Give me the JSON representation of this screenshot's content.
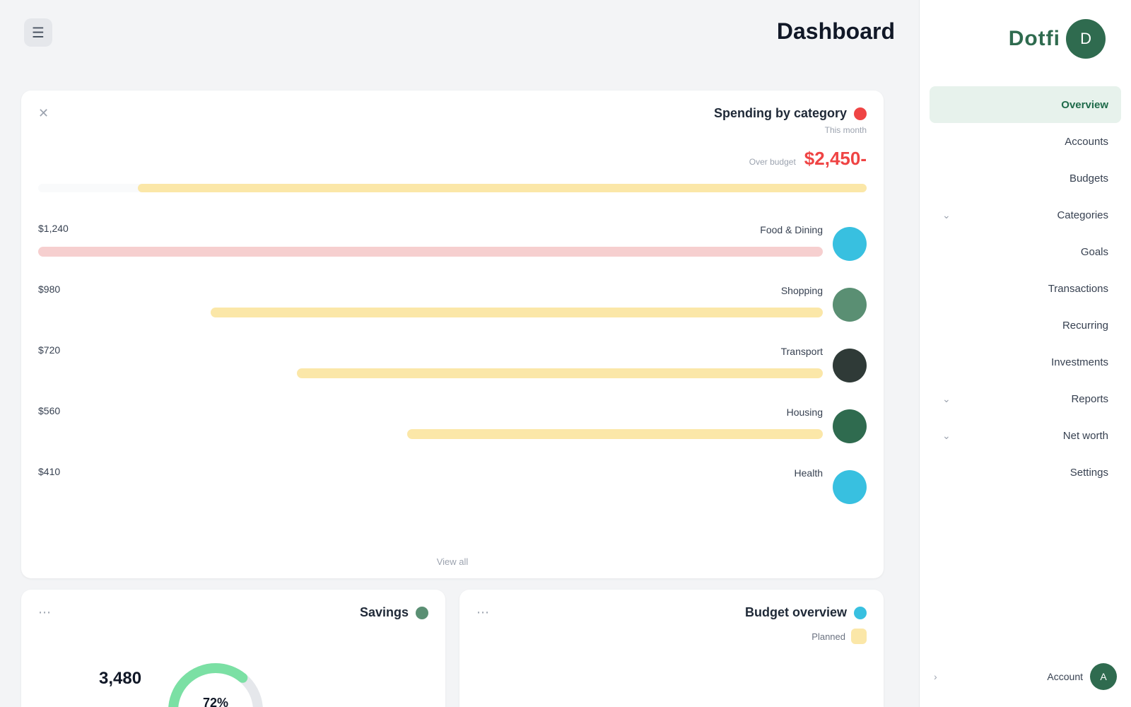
{
  "brand": {
    "name": "Dotfi",
    "logo_letter": "D"
  },
  "sidebar": {
    "items": [
      {
        "label": "Overview",
        "active": true,
        "chevron": false
      },
      {
        "label": "Accounts",
        "active": false,
        "chevron": false
      },
      {
        "label": "Budgets",
        "active": false,
        "chevron": false
      },
      {
        "label": "Categories",
        "active": false,
        "chevron": true
      },
      {
        "label": "Goals",
        "active": false,
        "chevron": false
      },
      {
        "label": "Transactions",
        "active": false,
        "chevron": false
      },
      {
        "label": "Recurring",
        "active": false,
        "chevron": false
      },
      {
        "label": "Investments",
        "active": false,
        "chevron": false
      },
      {
        "label": "Reports",
        "active": false,
        "chevron": true
      },
      {
        "label": "Net worth",
        "active": false,
        "chevron": true
      },
      {
        "label": "Settings",
        "active": false,
        "chevron": false
      }
    ],
    "footer": {
      "user_name": "Account",
      "avatar_initial": "A"
    }
  },
  "header": {
    "title": "Dashboard",
    "subtitle": ""
  },
  "main_card": {
    "title": "Spending by category",
    "subtitle": "This month",
    "stat_value": "-$2,450",
    "stat_label": "Over budget",
    "stat_note": "",
    "overall_progress": 0.88,
    "overall_color": "#fbe7a8",
    "rows": [
      {
        "label": "Food & Dining",
        "amount": "$1,240",
        "sub": "",
        "progress": 1.0,
        "bar_color": "#f6cfcf",
        "avatar_color": "#38c0e0"
      },
      {
        "label": "Shopping",
        "amount": "$980",
        "sub": "",
        "progress": 0.78,
        "bar_color": "#fbe7a8",
        "avatar_color": "#5a8f73"
      },
      {
        "label": "Transport",
        "amount": "$720",
        "sub": "",
        "progress": 0.67,
        "bar_color": "#fbe7a8",
        "avatar_color": "#2f3a37"
      },
      {
        "label": "Housing",
        "amount": "$560",
        "sub": "",
        "progress": 0.53,
        "bar_color": "#fbe7a8",
        "avatar_color": "#2f6b4f"
      },
      {
        "label": "Health",
        "amount": "$410",
        "sub": "",
        "progress": 0.0,
        "bar_color": "#fbe7a8",
        "avatar_color": "#38c0e0"
      }
    ],
    "footer_link": "View all"
  },
  "bottom_right_card": {
    "title": "Budget overview",
    "subtitle": "",
    "legend": [
      {
        "label": "Planned",
        "color": "#fbe7a8"
      }
    ]
  },
  "bottom_left_card": {
    "title": "Savings",
    "value": "3,480",
    "percent": "72%",
    "gauge_color": "#7be0a4"
  },
  "colors": {
    "accent": "#2f6b4f",
    "danger": "#ef4444"
  }
}
